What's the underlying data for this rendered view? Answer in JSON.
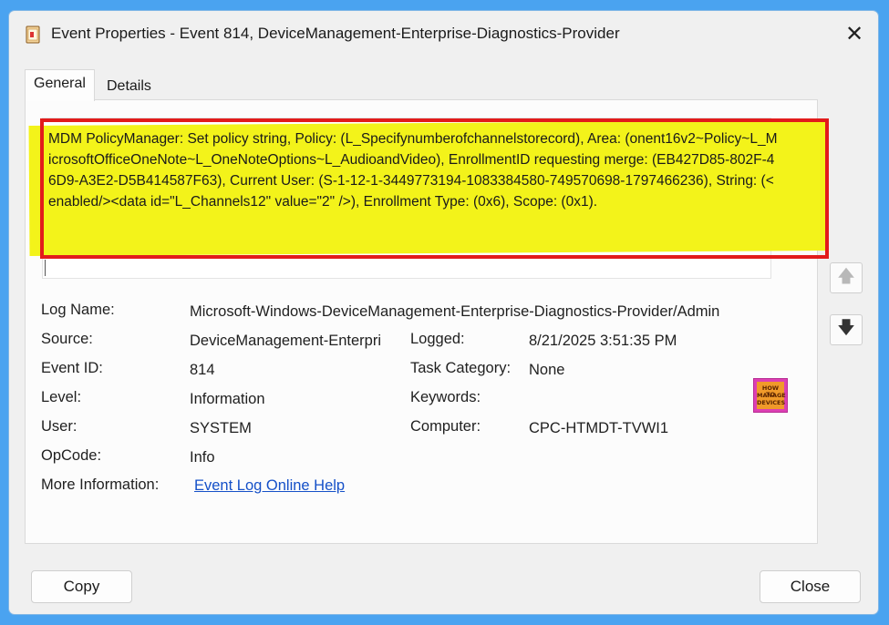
{
  "window": {
    "title": "Event Properties - Event 814, DeviceManagement-Enterprise-Diagnostics-Provider",
    "close_glyph": "✕"
  },
  "tabs": [
    {
      "label": "General",
      "selected": true
    },
    {
      "label": "Details",
      "selected": false
    }
  ],
  "description": "MDM PolicyManager: Set policy string, Policy: (L_Specifynumberofchannelstorecord), Area: (onent16v2~Policy~L_MicrosoftOfficeOneNote~L_OneNoteOptions~L_AudioandVideo), EnrollmentID requesting merge: (EB427D85-802F-46D9-A3E2-D5B414587F63), Current User: (S-1-12-1-3449773194-1083384580-749570698-1797466236), String: (<enabled/><data id=\"L_Channels12\" value=\"2\" />), Enrollment Type: (0x6), Scope: (0x1).",
  "nav": {
    "up_icon": "arrow-up-icon",
    "down_icon": "arrow-down-icon",
    "up_glyph": "🡅",
    "down_glyph": "🡇"
  },
  "fields": {
    "log_name": {
      "label": "Log Name:",
      "value": "Microsoft-Windows-DeviceManagement-Enterprise-Diagnostics-Provider/Admin"
    },
    "source": {
      "label": "Source:",
      "value": "DeviceManagement-Enterpri"
    },
    "logged": {
      "label": "Logged:",
      "value": "8/21/2025 3:51:35 PM"
    },
    "event_id": {
      "label": "Event ID:",
      "value": "814"
    },
    "task_category": {
      "label": "Task Category:",
      "value": "None"
    },
    "level": {
      "label": "Level:",
      "value": "Information"
    },
    "keywords": {
      "label": "Keywords:",
      "value": ""
    },
    "user": {
      "label": "User:",
      "value": "SYSTEM"
    },
    "computer": {
      "label": "Computer:",
      "value": "CPC-HTMDT-TVWI1"
    },
    "opcode": {
      "label": "OpCode:",
      "value": "Info"
    },
    "more_info": {
      "label": "More Information:",
      "link": "Event Log Online Help"
    }
  },
  "logo": {
    "line1": "HOW TO",
    "line2": "MANAGE",
    "line3": "DEVICES"
  },
  "buttons": {
    "copy": "Copy",
    "close": "Close"
  },
  "colors": {
    "highlight": "#f3f31a",
    "annotation_border": "#e21b1b",
    "link": "#1550c8",
    "background": "#4aa3f0"
  }
}
